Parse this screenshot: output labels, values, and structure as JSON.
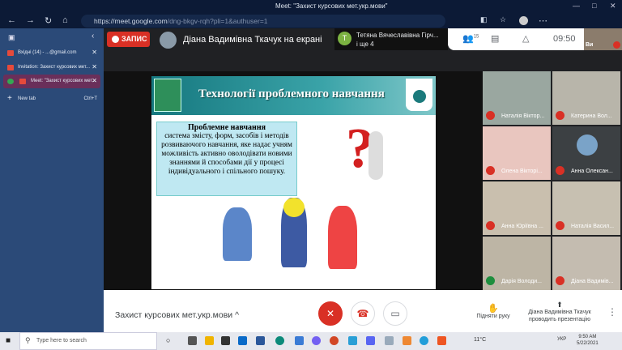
{
  "window": {
    "title": "Meet: \"Захист курсових мет.укр.мови\""
  },
  "browser": {
    "url_host": "https://meet.google.com",
    "url_path": "/dng-bkgv-rqh?pli=1&authuser=1"
  },
  "sidebar": {
    "tabs": [
      {
        "label": "Вхідні (14) - ...@gmail.com"
      },
      {
        "label": "Invitation: Захист курсових мет..."
      },
      {
        "label": "Meet: \"Захист курсових мет..."
      }
    ],
    "new_tab": "New tab",
    "new_tab_shortcut": "Ctrl+T"
  },
  "meet": {
    "record_label": "ЗАПИС",
    "presenter_text": "Діана Вадимівна Ткачук на екрані",
    "participant_preview": {
      "avatar": "T",
      "name": "Тетяна Вячеславівна Гірч...",
      "more": "і ще 4"
    },
    "people_count": "15",
    "time": "09:50",
    "self_label": "Ви",
    "meeting_name": "Захист курсових мет.укр.мови",
    "raise_hand": "Підняти руку",
    "presenting_line1": "Діана Вадимівна Ткачук",
    "presenting_line2": "проводить презентацію",
    "participants": [
      "Наталія Віктор...",
      "Катерина Вол...",
      "Олена Вікторі...",
      "Анна Олексан...",
      "Анна Юріївна ...",
      "Наталія Васил...",
      "Дарія Володи...",
      "Діана Вадимів..."
    ]
  },
  "slide": {
    "title": "Технології проблемного навчання",
    "box_heading": "Проблемне навчання",
    "box_text": "система змісту, форм, засобів і методів розвиваючого навчання, яке надає учням можливість активно оволодівати новими знаннями й способами дії у процесі індивідуального і спільного пошуку."
  },
  "taskbar": {
    "search_placeholder": "Type here to search",
    "weather": "11°C",
    "lang": "УКР",
    "time": "9:50 AM",
    "date": "5/22/2021"
  },
  "colors": {
    "record": "#d93025",
    "sidebar": "#2b4a78",
    "titlebar": "#0c1a36"
  }
}
